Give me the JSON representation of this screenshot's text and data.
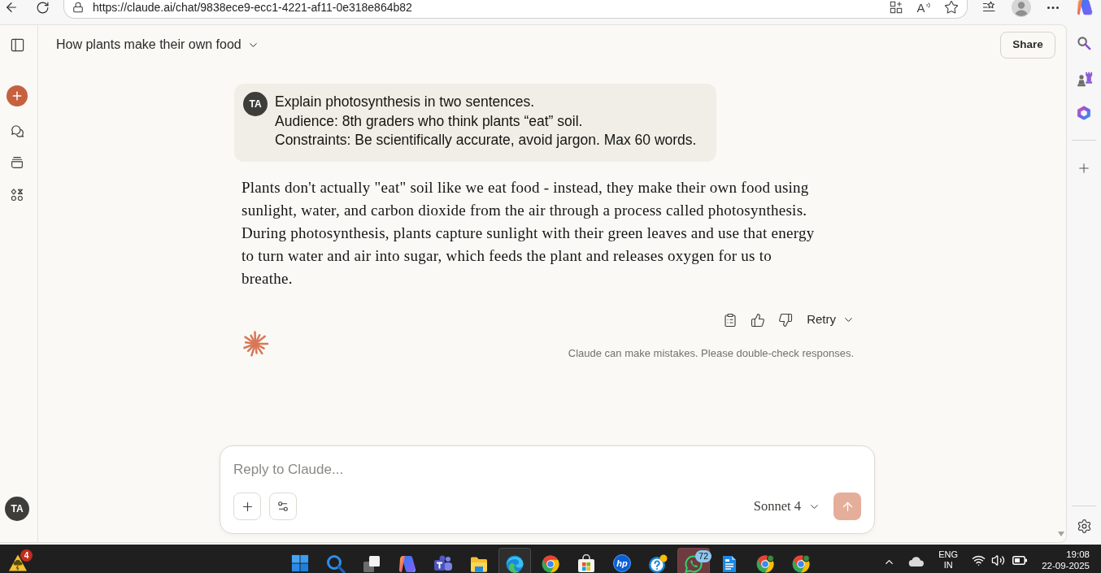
{
  "browser": {
    "url": "https://claude.ai/chat/9838ece9-ecc1-4221-af11-0e318e864b82",
    "read_aloud": "A"
  },
  "sidebar": {
    "user_initials": "TA"
  },
  "header": {
    "title": "How plants make their own food",
    "share": "Share"
  },
  "user_message": {
    "initials": "TA",
    "text": "Explain photosynthesis in two sentences.\nAudience: 8th graders who think plants “eat” soil.\nConstraints: Be scientifically accurate, avoid jargon. Max 60 words."
  },
  "response": {
    "text": "Plants don't actually \"eat\" soil like we eat food - instead, they make their own food using\nsunlight, water, and carbon dioxide from the air through a process called photosynthesis.\nDuring photosynthesis, plants capture sunlight with their green leaves and use that energy\nto turn water and air into sugar, which feeds the plant and releases oxygen for us to\nbreathe.",
    "retry": "Retry",
    "disclaimer": "Claude can make mistakes. Please double-check responses."
  },
  "composer": {
    "placeholder": "Reply to Claude...",
    "model": "Sonnet 4",
    "send_disabled": true
  },
  "taskbar": {
    "weather_badge": "4",
    "apps": [
      {
        "kind": "start",
        "selected": false,
        "attention": false
      },
      {
        "kind": "search",
        "selected": false,
        "attention": false
      },
      {
        "kind": "taskview",
        "selected": false,
        "attention": false
      },
      {
        "kind": "copilot",
        "selected": false,
        "attention": false
      },
      {
        "kind": "teams",
        "selected": false,
        "attention": false
      },
      {
        "kind": "explorer",
        "selected": false,
        "attention": false
      },
      {
        "kind": "edge",
        "selected": true,
        "attention": false
      },
      {
        "kind": "chrome",
        "selected": false,
        "attention": false
      },
      {
        "kind": "store",
        "selected": false,
        "attention": false
      },
      {
        "kind": "hp",
        "label": "hp",
        "selected": false,
        "attention": false
      },
      {
        "kind": "help",
        "selected": false,
        "attention": false
      },
      {
        "kind": "whatsapp",
        "badge": "72",
        "selected": false,
        "attention": true
      },
      {
        "kind": "writer",
        "selected": false,
        "attention": false
      },
      {
        "kind": "chromeprofile",
        "selected": false,
        "attention": false
      },
      {
        "kind": "chromeprofile",
        "selected": false,
        "attention": false
      }
    ],
    "tray": {
      "language": "ENG",
      "region": "IN",
      "time": "19:08",
      "date": "22-09-2025"
    }
  }
}
